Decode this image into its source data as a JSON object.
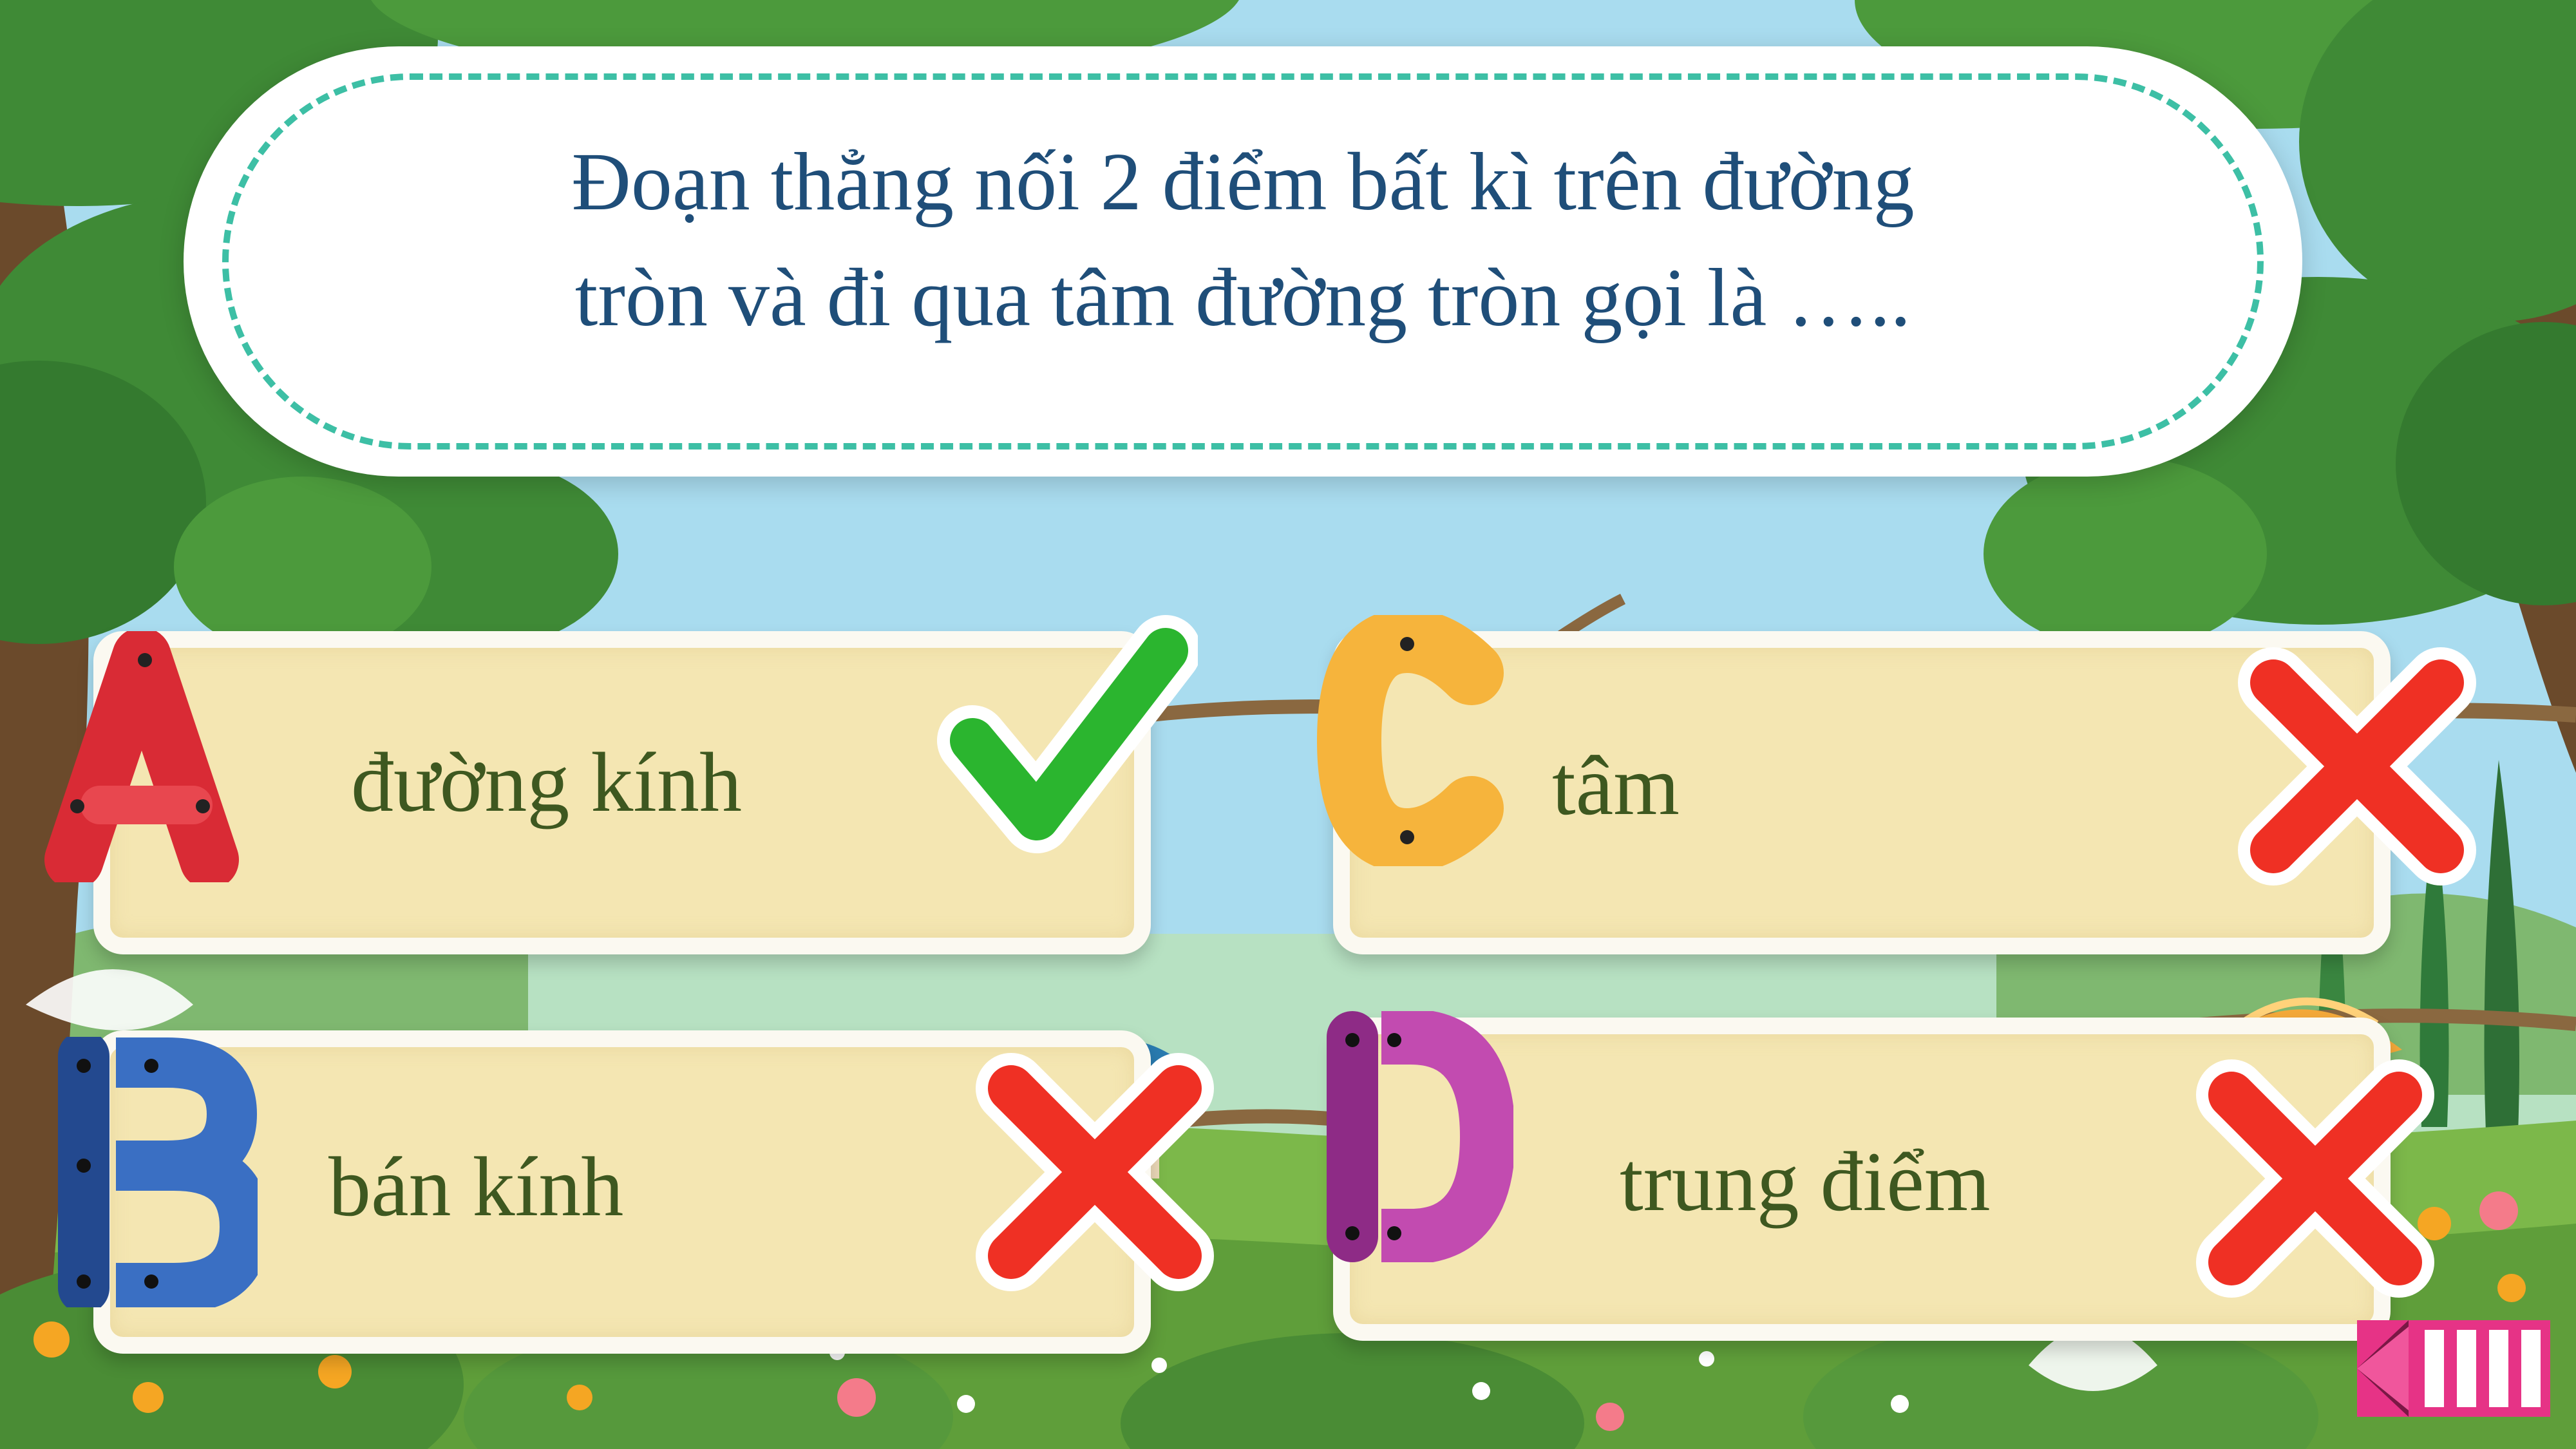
{
  "question": {
    "line1": "Đoạn thẳng nối 2 điểm bất kì trên đường",
    "line2": "tròn và đi qua tâm đường tròn gọi là ….."
  },
  "answers": [
    {
      "letter": "A",
      "text": "đường kính",
      "correct": true,
      "letter_color": "#d92b35"
    },
    {
      "letter": "B",
      "text": "bán kính",
      "correct": false,
      "letter_color": "#2f63b6"
    },
    {
      "letter": "C",
      "text": "tâm",
      "correct": false,
      "letter_color": "#f6b43c"
    },
    {
      "letter": "D",
      "text": "trung điểm",
      "correct": false,
      "letter_color": "#b53ea5"
    }
  ],
  "colors": {
    "sky": "#a9dcef",
    "foliage": "#3f8a36",
    "grass": "#7cb84a",
    "question_text": "#1f4e79",
    "dash": "#3dbfa5",
    "card": "#f4e6b2",
    "answer_text": "#3e5820",
    "check": "#2bb52f",
    "cross": "#ef3024",
    "back_button": "#e63386"
  },
  "icons": {
    "correct": "check-icon",
    "wrong": "cross-icon",
    "back": "back-arrow-icon"
  }
}
